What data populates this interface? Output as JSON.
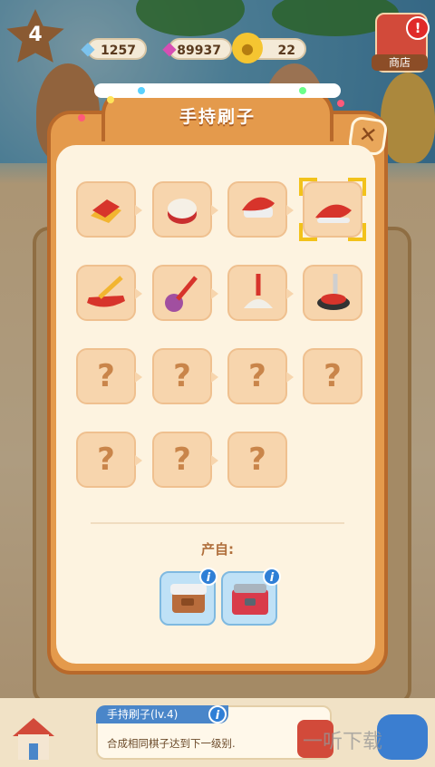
{
  "hud": {
    "level": "4",
    "diamonds": "1257",
    "gems": "89937",
    "coins": "22",
    "shop_label": "商店",
    "shop_alert": "!"
  },
  "dialog": {
    "title": "手持刷子",
    "close_icon": "✕",
    "selected_index": 3,
    "items": [
      {
        "icon": "red-cloth-icon",
        "unknown": false
      },
      {
        "icon": "sponge-icon",
        "unknown": false
      },
      {
        "icon": "scrub-brush-icon",
        "unknown": false
      },
      {
        "icon": "hand-brush-icon",
        "unknown": false
      },
      {
        "icon": "dustpan-brush-icon",
        "unknown": false
      },
      {
        "icon": "feather-duster-icon",
        "unknown": false
      },
      {
        "icon": "mop-icon",
        "unknown": false
      },
      {
        "icon": "floor-scrubber-icon",
        "unknown": false
      },
      {
        "icon": "unknown-item-icon",
        "unknown": true,
        "label": "?"
      },
      {
        "icon": "unknown-item-icon",
        "unknown": true,
        "label": "?"
      },
      {
        "icon": "unknown-item-icon",
        "unknown": true,
        "label": "?"
      },
      {
        "icon": "unknown-item-icon",
        "unknown": true,
        "label": "?"
      },
      {
        "icon": "unknown-item-icon",
        "unknown": true,
        "label": "?"
      },
      {
        "icon": "unknown-item-icon",
        "unknown": true,
        "label": "?"
      },
      {
        "icon": "unknown-item-icon",
        "unknown": true,
        "label": "?"
      }
    ],
    "source_label": "产自:",
    "sources": [
      {
        "icon": "storage-box-icon"
      },
      {
        "icon": "toolbox-icon"
      }
    ]
  },
  "info_card": {
    "title": "手持刷子(lv.4)",
    "text": "合成相同棋子达到下一级别."
  },
  "watermark": "一听下载"
}
